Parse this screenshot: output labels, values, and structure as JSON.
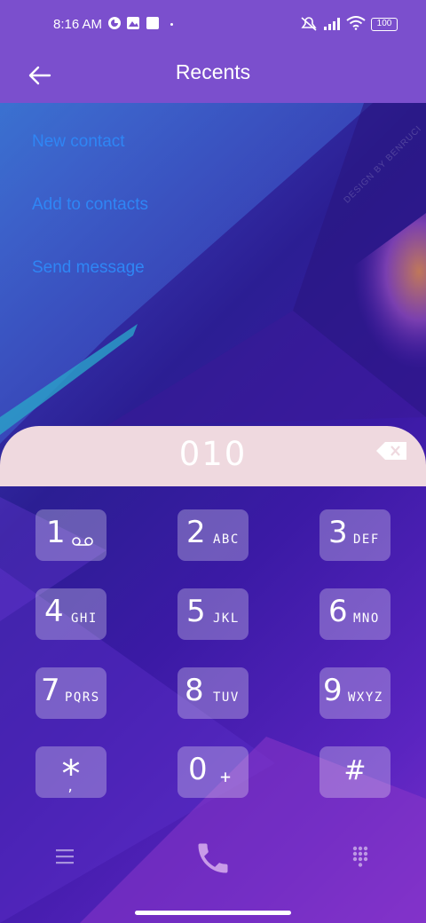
{
  "status_bar": {
    "time": "8:16 AM",
    "battery": "100",
    "icons": [
      "data-saver-icon",
      "gallery-icon",
      "notification-icon",
      "dot-icon",
      "mute-icon",
      "signal-icon",
      "wifi-icon",
      "battery-icon"
    ]
  },
  "app_bar": {
    "title": "Recents",
    "back_icon": "back-arrow-icon"
  },
  "menu": {
    "items": [
      {
        "label": "New contact"
      },
      {
        "label": "Add to contacts"
      },
      {
        "label": "Send message"
      }
    ]
  },
  "wallpaper": {
    "watermark": "DESIGN BY BENRUCI"
  },
  "dialer": {
    "number": "010",
    "backspace_icon": "backspace-icon",
    "keys": [
      {
        "digit": "1",
        "letters": "",
        "icon": "voicemail-icon"
      },
      {
        "digit": "2",
        "letters": "ABC"
      },
      {
        "digit": "3",
        "letters": "DEF"
      },
      {
        "digit": "4",
        "letters": "GHI"
      },
      {
        "digit": "5",
        "letters": "JKL"
      },
      {
        "digit": "6",
        "letters": "MNO"
      },
      {
        "digit": "7",
        "letters": "PQRS"
      },
      {
        "digit": "8",
        "letters": "TUV"
      },
      {
        "digit": "9",
        "letters": "WXYZ"
      },
      {
        "digit": "*",
        "letters": ","
      },
      {
        "digit": "0",
        "letters": "+"
      },
      {
        "digit": "#",
        "letters": ""
      }
    ]
  },
  "bottom_nav": {
    "items": [
      "menu-icon",
      "call-icon",
      "dialpad-icon"
    ]
  },
  "colors": {
    "accent": "#7b4fcd",
    "link": "#2f86f5",
    "display_bg": "#efd9df",
    "call_icon": "#c89be8"
  }
}
